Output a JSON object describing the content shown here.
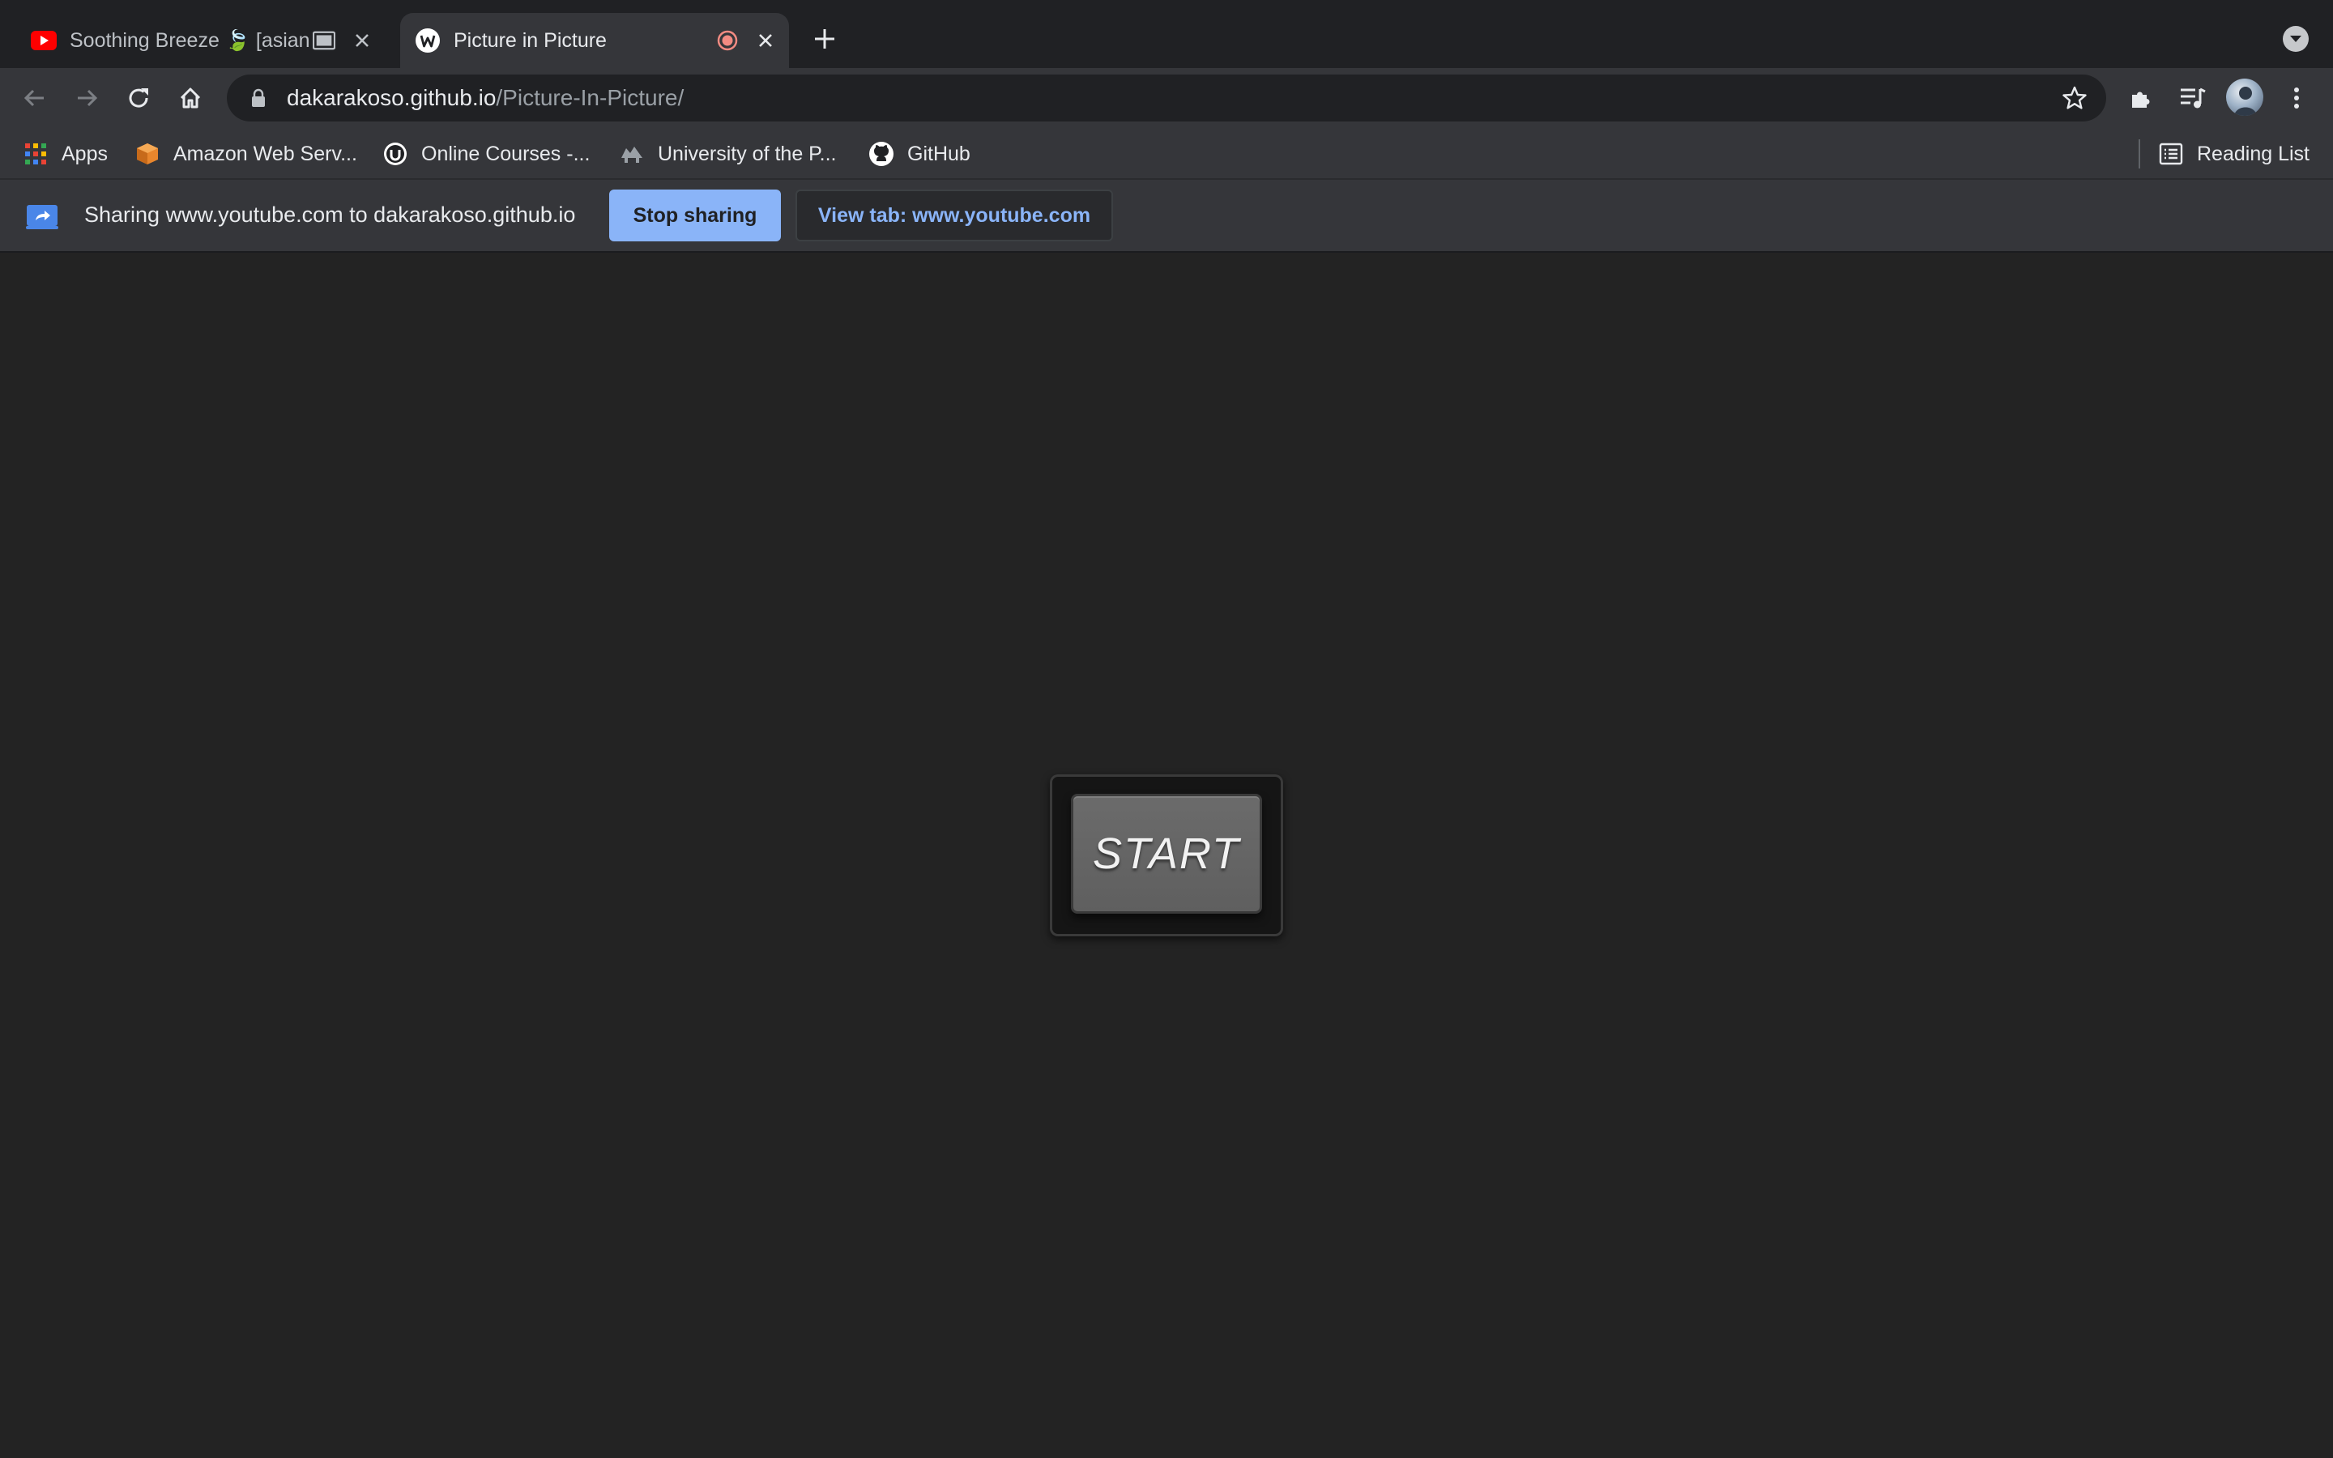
{
  "tabs": [
    {
      "title": "Soothing Breeze 🍃 [asian",
      "favicon": "youtube-icon",
      "active": false
    },
    {
      "title": "Picture in Picture",
      "favicon": "w-logo-icon",
      "active": true
    }
  ],
  "toolbar": {
    "url_host": "dakarakoso.github.io",
    "url_path": "/Picture-In-Picture/"
  },
  "bookmarks": {
    "items": [
      {
        "label": "Apps",
        "icon": "apps-grid-icon"
      },
      {
        "label": "Amazon Web Serv...",
        "icon": "aws-box-icon"
      },
      {
        "label": "Online Courses -...",
        "icon": "udemy-icon"
      },
      {
        "label": "University of the P...",
        "icon": "university-icon"
      },
      {
        "label": "GitHub",
        "icon": "github-icon"
      }
    ],
    "reading_list": "Reading List"
  },
  "infobar": {
    "message": "Sharing www.youtube.com to dakarakoso.github.io",
    "stop_label": "Stop sharing",
    "view_label": "View tab: www.youtube.com"
  },
  "page": {
    "start_label": "START"
  },
  "colors": {
    "accent": "#8ab4f8",
    "page_bg": "#232323",
    "youtube_red": "#ff0000",
    "recording": "#f28b82"
  }
}
